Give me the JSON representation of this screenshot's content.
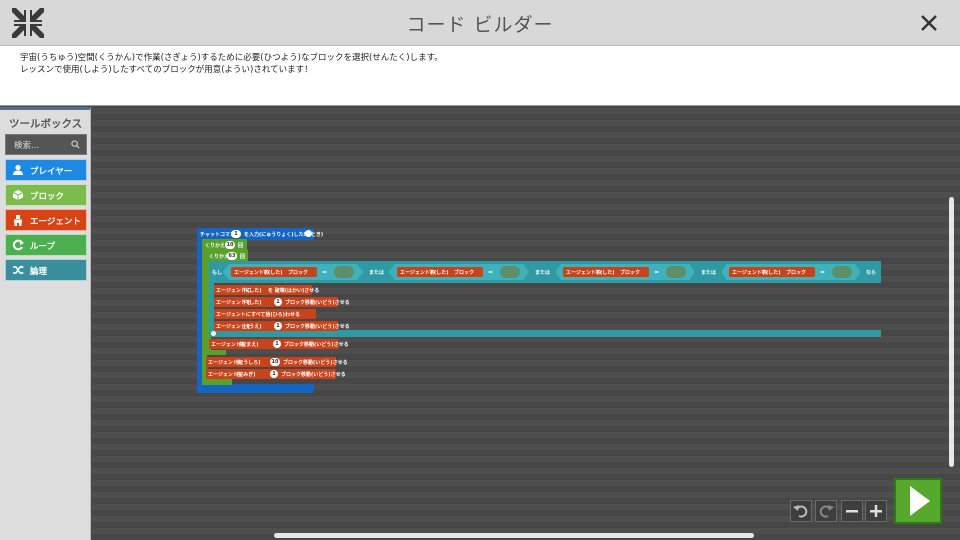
{
  "window": {
    "title": "コード ビルダー"
  },
  "instructions": {
    "line1": "宇宙(うちゅう)空間(くうかん)で作業(さぎょう)するために必要(ひつよう)なブロックを選択(せんたく)します。",
    "line2": "レッスンで使用(しよう)したすべてのブロックが用意(ようい)されています！"
  },
  "toolbox": {
    "title": "ツールボックス",
    "search_placeholder": "検索...",
    "categories": [
      {
        "label": "プレイヤー",
        "color": "#1e88e5",
        "icon": "person-icon"
      },
      {
        "label": "ブロック",
        "color": "#7cbb4e",
        "icon": "cube-icon"
      },
      {
        "label": "エージェント",
        "color": "#d84315",
        "icon": "agent-icon"
      },
      {
        "label": "ループ",
        "color": "#4caf50",
        "icon": "loop-icon"
      },
      {
        "label": "論理",
        "color": "#3a8f9c",
        "icon": "shuffle-icon"
      }
    ]
  },
  "colors": {
    "player": "#1565c0",
    "loop": "#5aa02c",
    "agent": "#c8421a",
    "logic": "#2f9aa4"
  },
  "blocks": {
    "chat_command": "チャットコマンド",
    "chat_num": "1",
    "chat_suffix": "を入力(にゅうりょく)した時(とき)",
    "repeat1": "くりかえし",
    "repeat1_num": "10",
    "repeat1_suffix": "回",
    "repeat2": "くりかえし",
    "repeat2_num": "63",
    "repeat2_suffix": "回",
    "if_label": "もし",
    "or_label": "または",
    "cond_agent": "エージェントの",
    "cond_dir": "下(した)",
    "cond_block": "ブロック",
    "eq": "＝",
    "then_label": "なら",
    "a1": "エージェントに",
    "a1_dir": "下(した)",
    "a1_suffix": "を 破壊(はかい)させる",
    "a2": "エージェントを",
    "a2_dir": "下(した)",
    "a2_num": "1",
    "a2_suffix": "ブロック移動(いどう)させる",
    "a3": "エージェントにすべて拾(ひろ)わせる",
    "a4": "エージェントを",
    "a4_dir": "上(うえ)",
    "a4_num": "1",
    "a4_suffix": "ブロック移動(いどう)させる",
    "a5": "エージェントを",
    "a5_dir": "前(まえ)",
    "a5_num": "1",
    "a5_suffix": "ブロック移動(いどう)させる",
    "a6": "エージェントを",
    "a6_dir": "後(うしろ)",
    "a6_num": "10",
    "a6_suffix": "ブロック移動(いどう)させる",
    "a7": "エージェントを",
    "a7_dir": "右(みぎ)",
    "a7_num": "1",
    "a7_suffix": "ブロック移動(いどう)させる"
  }
}
